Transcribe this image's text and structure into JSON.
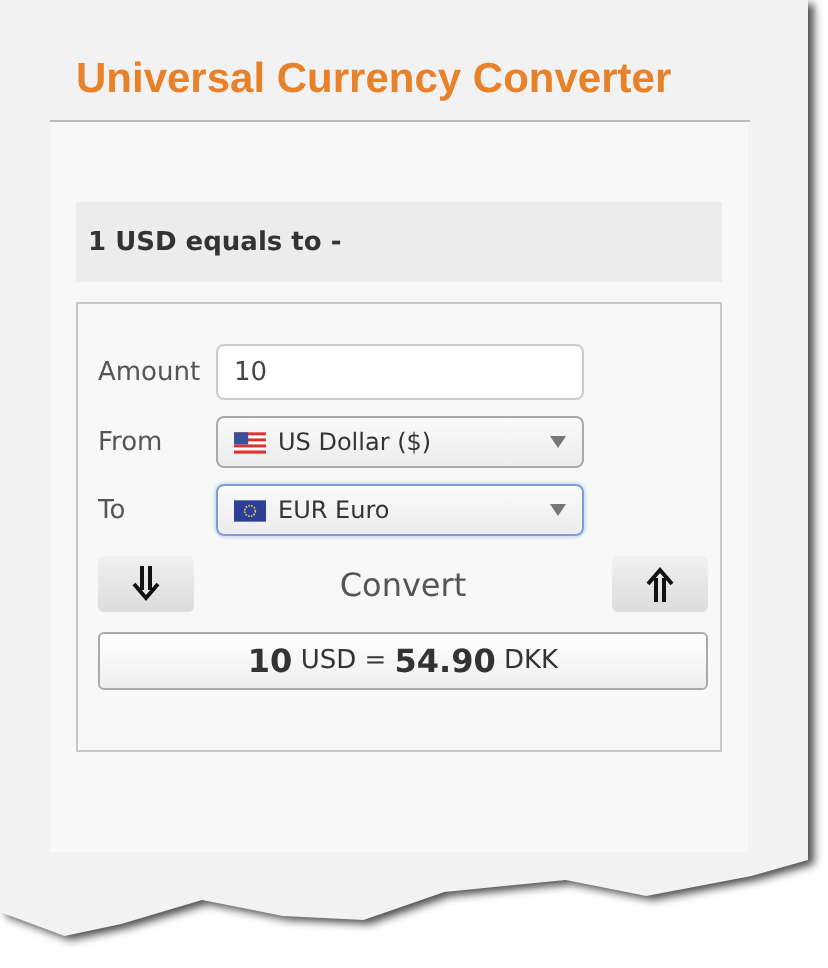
{
  "heading": "Universal Currency Converter",
  "rate_heading": "1 USD equals to -",
  "amount": {
    "label": "Amount",
    "value": "10"
  },
  "from": {
    "label": "From",
    "value": "US Dollar ($)",
    "kind": "us",
    "focused": false
  },
  "to": {
    "label": "To",
    "value": "EUR Euro",
    "kind": "eu",
    "focused": true
  },
  "convert_label": "Convert",
  "result": "**10** USD = **54.90** DKK"
}
